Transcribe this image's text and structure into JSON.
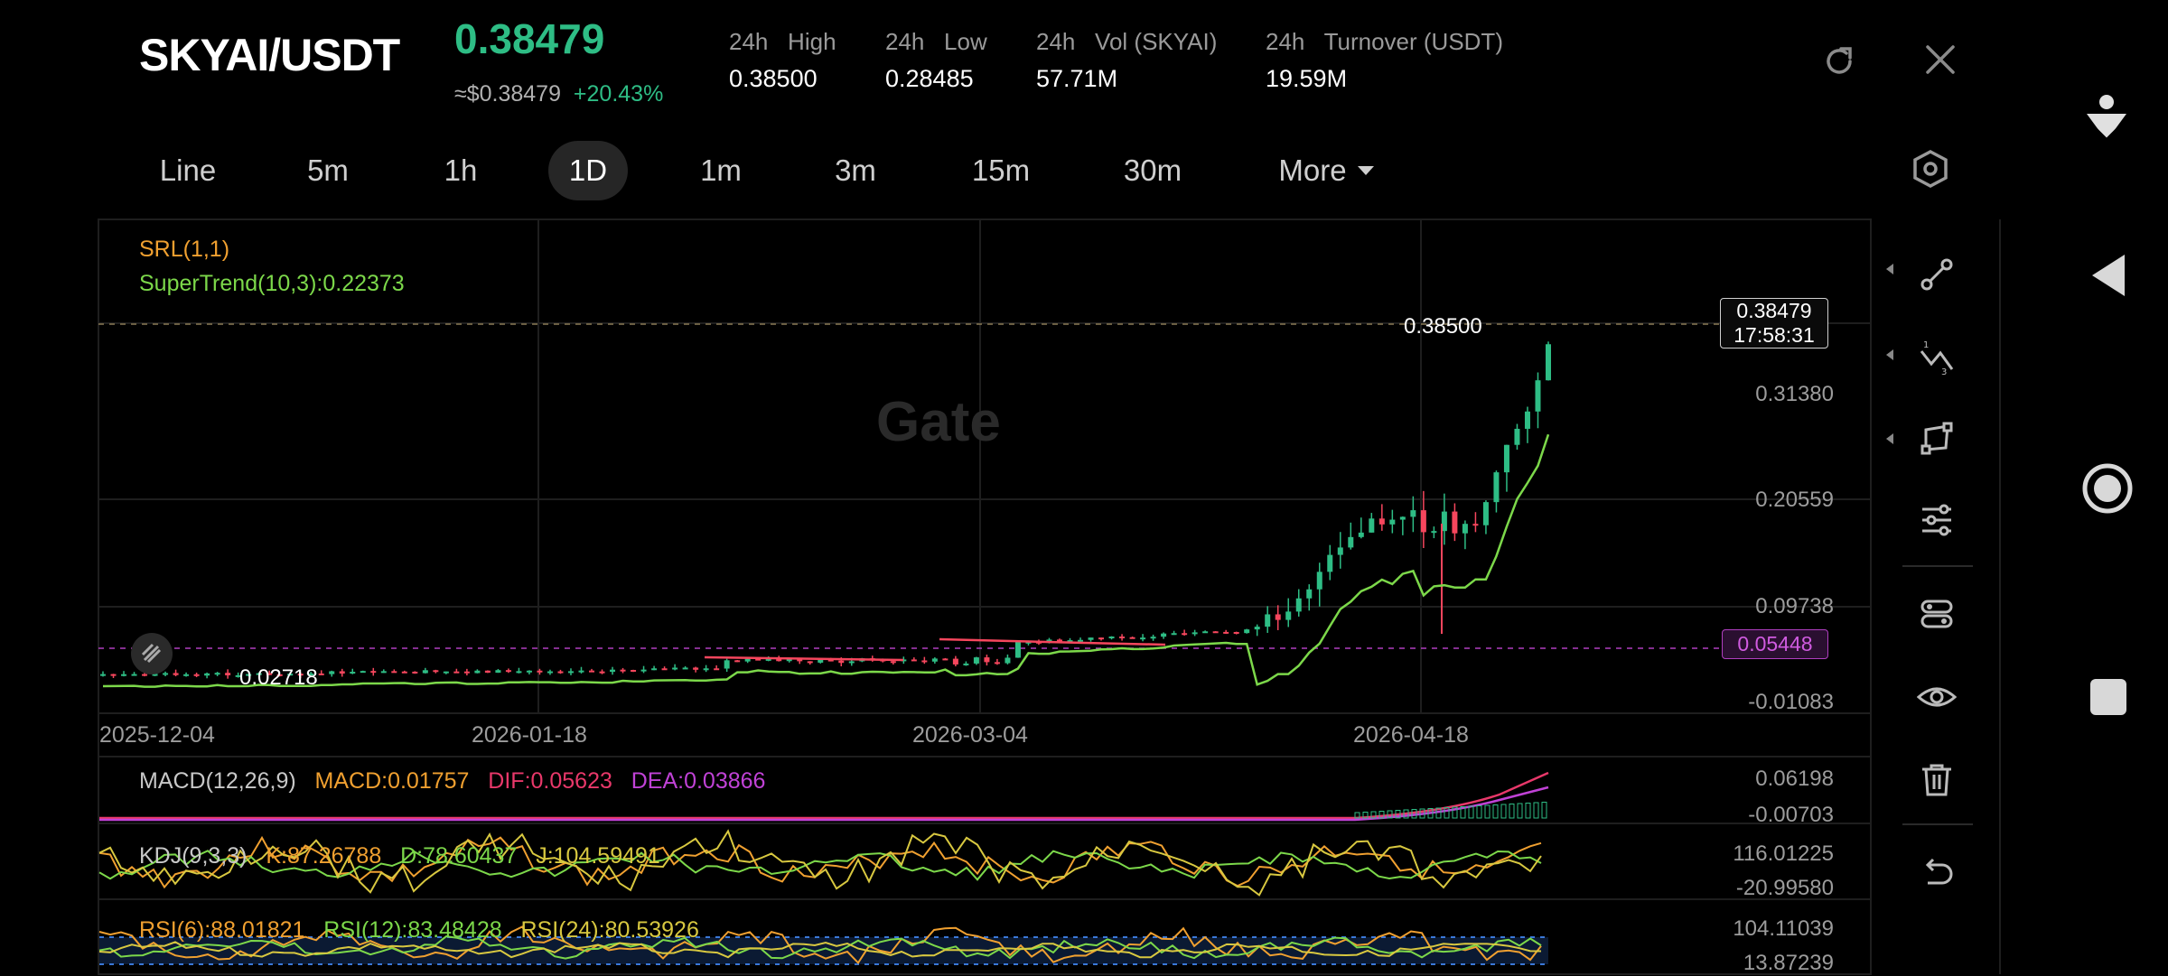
{
  "header": {
    "pair": "SKYAI/USDT",
    "last_price": "0.38479",
    "usd_price": "≈$0.38479",
    "change_pct": "+20.43%",
    "stats": [
      {
        "label": "24h   High",
        "value": "0.38500"
      },
      {
        "label": "24h   Low",
        "value": "0.28485"
      },
      {
        "label": "24h   Vol (SKYAI)",
        "value": "57.71M"
      },
      {
        "label": "24h   Turnover (USDT)",
        "value": "19.59M"
      }
    ]
  },
  "timeframes": [
    "Line",
    "5m",
    "1h",
    "1D",
    "1m",
    "3m",
    "15m",
    "30m"
  ],
  "selected_timeframe": "1D",
  "more_label": "More",
  "indicators": {
    "srl": "SRL(1,1)",
    "supertrend": "SuperTrend(10,3):0.22373"
  },
  "price_axis": [
    "0.31380",
    "0.20559",
    "0.09738",
    "-0.01083"
  ],
  "high_marker": "0.38500",
  "low_marker": "0.02718",
  "last_price_tag": {
    "price": "0.38479",
    "countdown": "17:58:31"
  },
  "supertrend_tag": "0.05448",
  "watermark": "Gate",
  "dates": [
    "2025-12-04",
    "2026-01-18",
    "2026-03-04",
    "2026-04-18"
  ],
  "macd": {
    "title": "MACD(12,26,9)",
    "macd": "MACD:0.01757",
    "dif": "DIF:0.05623",
    "dea": "DEA:0.03866",
    "axis": [
      "0.06198",
      "-0.00703"
    ]
  },
  "kdj": {
    "title": "KDJ(9,3,3)",
    "k": "K:87.26788",
    "d": "D:78.60437",
    "j": "J:104.59491",
    "axis": [
      "116.01225",
      "-20.99580"
    ]
  },
  "rsi": {
    "rsi6": "RSI(6):88.01821",
    "rsi12": "RSI(12):83.48428",
    "rsi24": "RSI(24):80.53926",
    "axis": [
      "104.11039",
      "13.87239"
    ]
  },
  "colors": {
    "up": "#2ebd85",
    "down": "#f6465d",
    "supertrend": "#7cd84a",
    "accent_purple": "#c042d6",
    "orange": "#f0a030"
  }
}
